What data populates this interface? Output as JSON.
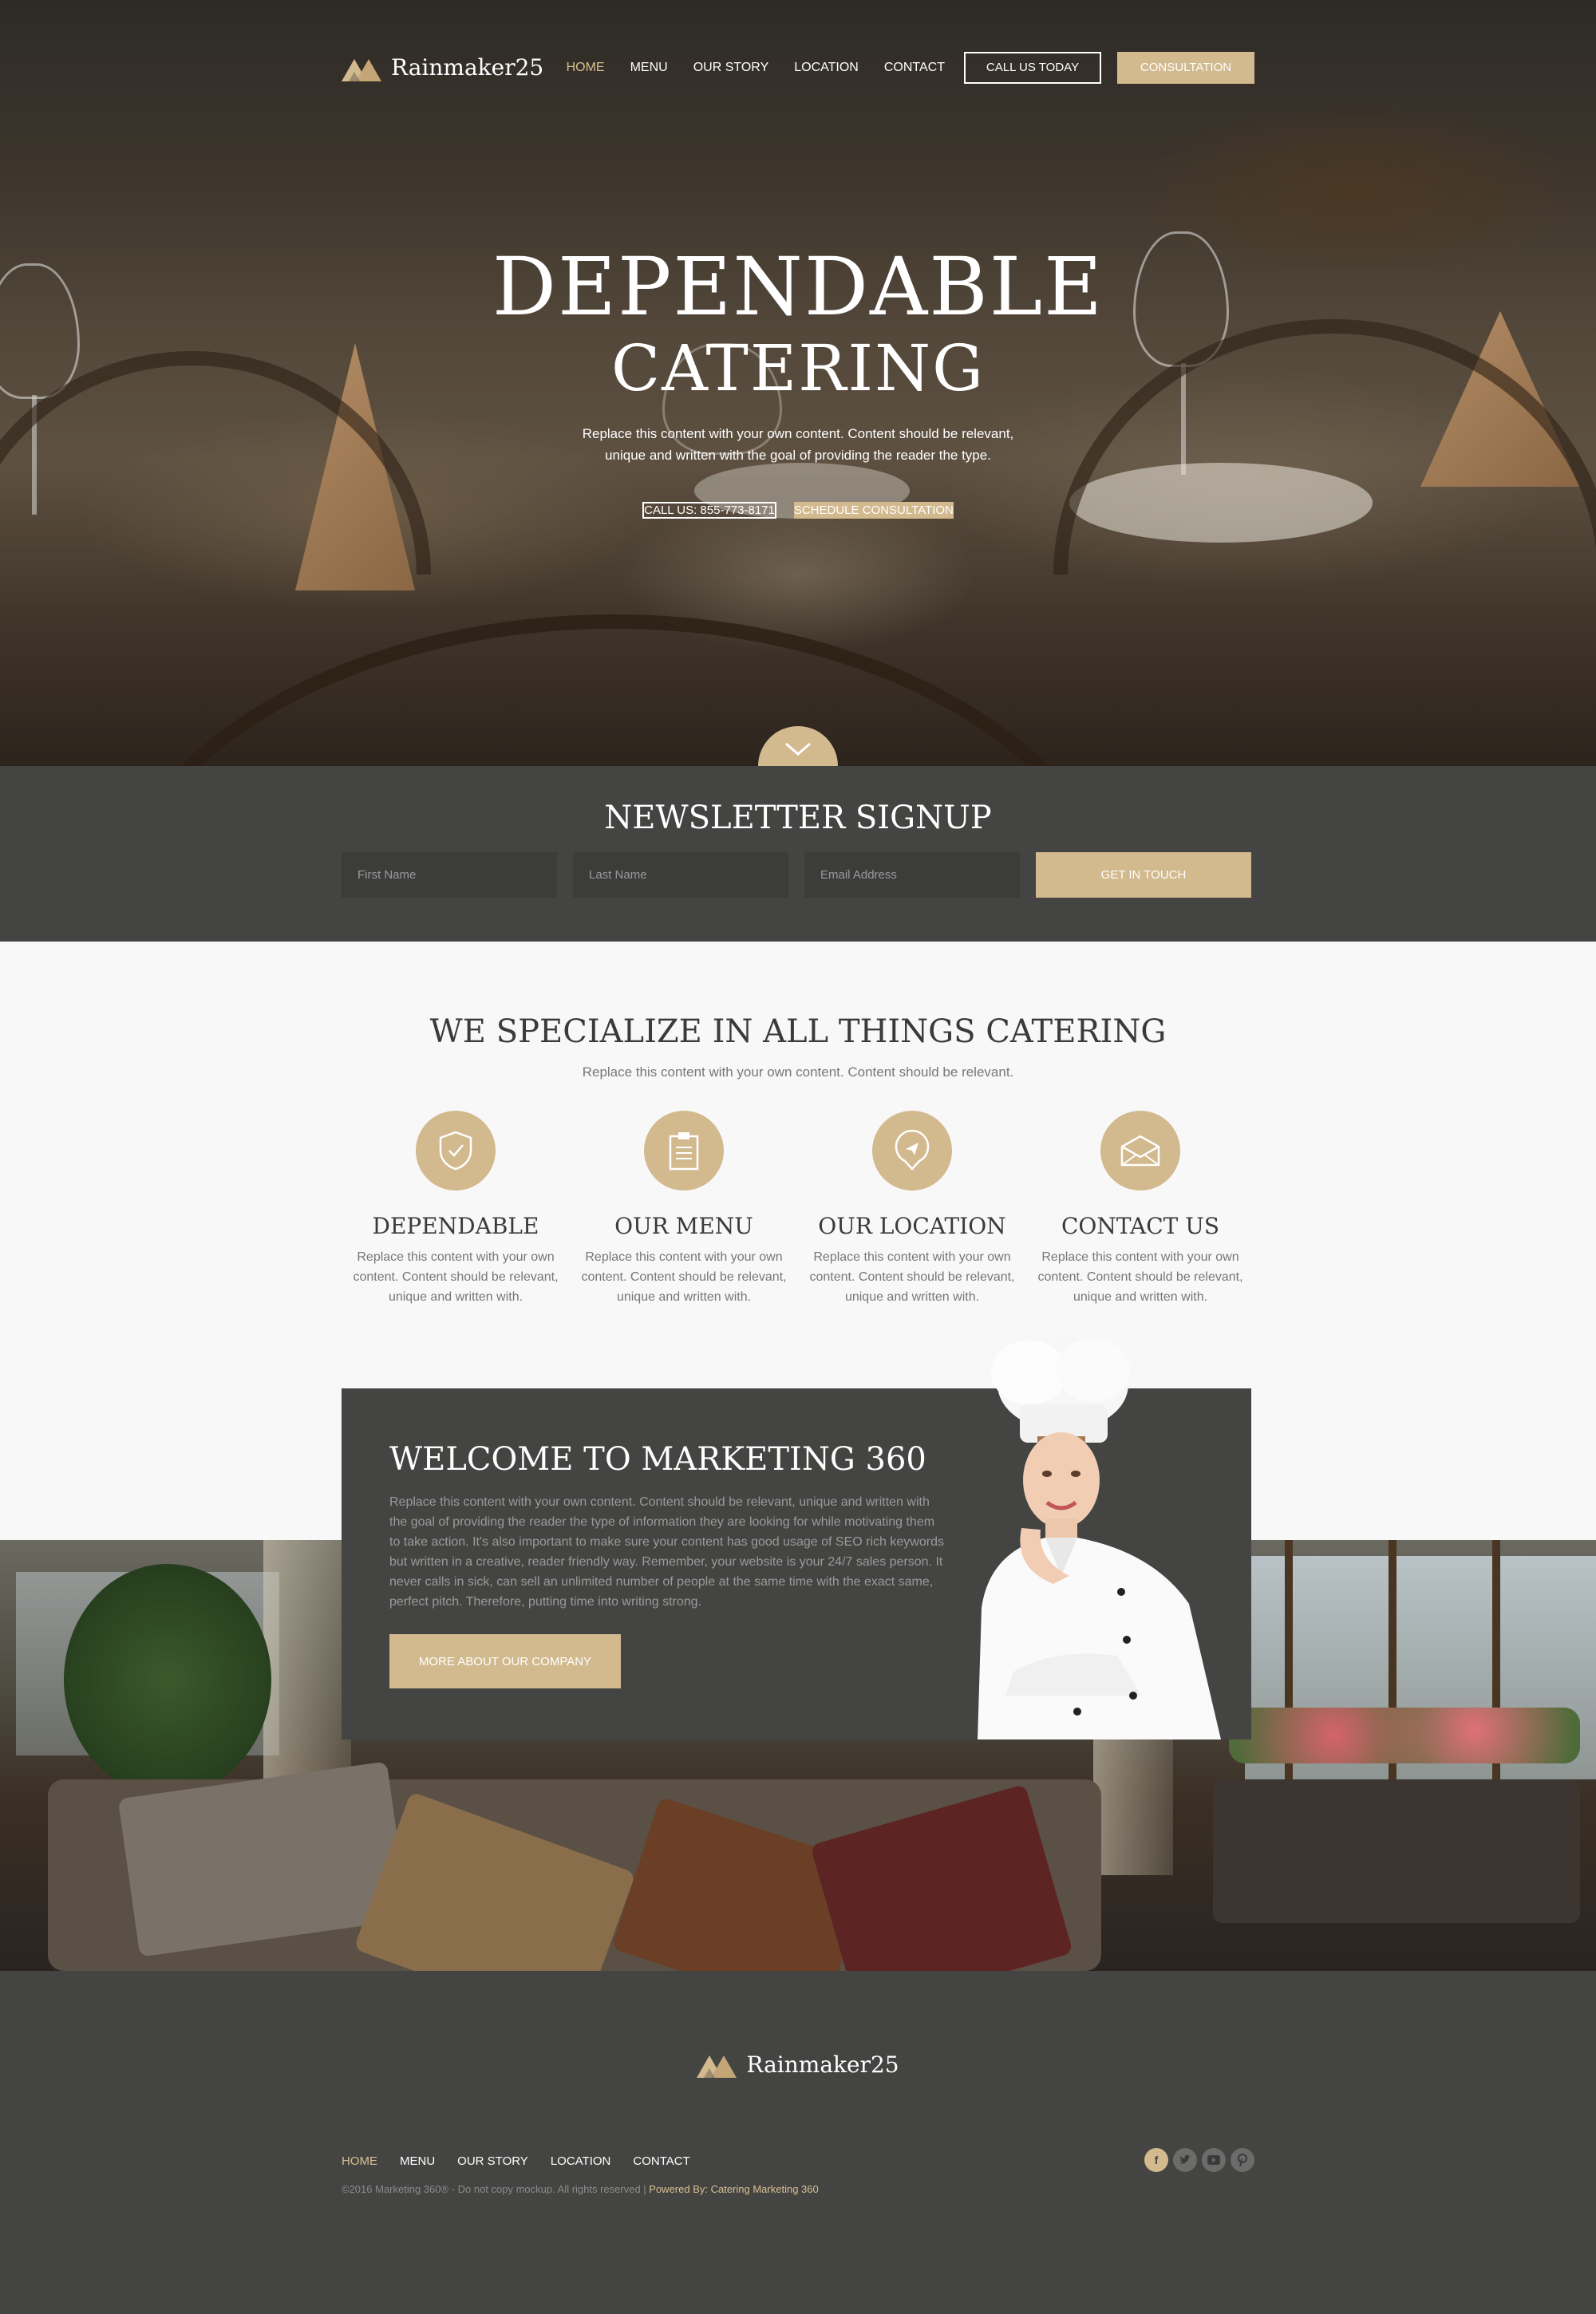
{
  "brand": {
    "name": "Rainmaker25",
    "accent": "#d2b98e",
    "dark": "#444443"
  },
  "nav": {
    "items": [
      {
        "label": "HOME",
        "active": true
      },
      {
        "label": "MENU"
      },
      {
        "label": "OUR STORY"
      },
      {
        "label": "LOCATION"
      },
      {
        "label": "CONTACT"
      }
    ],
    "call_button": "CALL US TODAY",
    "consult_button": "CONSULTATION"
  },
  "hero": {
    "title_line1": "DEPENDABLE",
    "title_line2": "CATERING",
    "text": "Replace this content with your own content. Content should be relevant, unique and written with the goal of providing the reader the type.",
    "call_button": "CALL US: 855-773-8171",
    "schedule_button": "SCHEDULE CONSULTATION",
    "scroll_icon": "chevron-down-icon"
  },
  "newsletter": {
    "title": "NEWSLETTER SIGNUP",
    "first_name_placeholder": "First Name",
    "last_name_placeholder": "Last Name",
    "email_placeholder": "Email Address",
    "submit_button": "GET IN TOUCH"
  },
  "specialize": {
    "title": "WE SPECIALIZE IN ALL THINGS CATERING",
    "subtitle": "Replace this content with your own content. Content should be relevant.",
    "features": [
      {
        "icon": "shield-icon",
        "title": "DEPENDABLE",
        "text": "Replace this content with your own content. Content should be relevant, unique and written with."
      },
      {
        "icon": "clipboard-icon",
        "title": "OUR MENU",
        "text": "Replace this content with your own content. Content should be relevant, unique and written with."
      },
      {
        "icon": "location-pin-icon",
        "title": "OUR LOCATION",
        "text": "Replace this content with your own content. Content should be relevant, unique and written with."
      },
      {
        "icon": "envelope-icon",
        "title": "CONTACT US",
        "text": "Replace this content with your own content. Content should be relevant, unique and written with."
      }
    ]
  },
  "welcome": {
    "title": "WELCOME TO MARKETING 360",
    "text": "Replace this content with your own content. Content should be relevant, unique and written with the goal of providing the reader the type of information they are looking for while motivating them to take action. It's also important to make sure your content has good usage of SEO rich keywords but written in a creative, reader friendly way. Remember, your website is your 24/7 sales person. It never calls in sick, can sell an unlimited number of people at the same time with the exact same, perfect pitch. Therefore, putting time into writing strong.",
    "button": "MORE ABOUT OUR COMPANY"
  },
  "footer": {
    "brand": "Rainmaker25",
    "nav": [
      {
        "label": "HOME",
        "active": true
      },
      {
        "label": "MENU"
      },
      {
        "label": "OUR STORY"
      },
      {
        "label": "LOCATION"
      },
      {
        "label": "CONTACT"
      }
    ],
    "copyright": "©2016 Marketing 360® - Do not copy mockup. All rights reserved | ",
    "powered_by": "Powered By: Catering Marketing 360",
    "social": [
      "facebook-icon",
      "twitter-icon",
      "youtube-icon",
      "pinterest-icon"
    ]
  }
}
